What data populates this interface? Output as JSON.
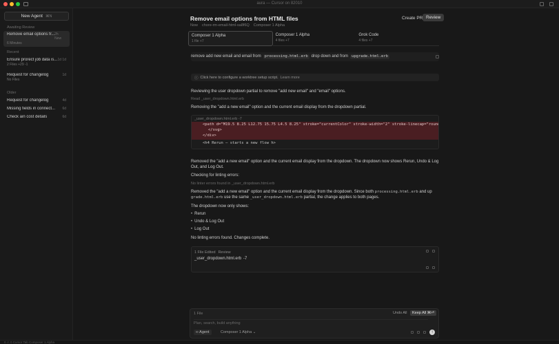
{
  "window": {
    "title": "aura — Cursor on 82010"
  },
  "sidebar": {
    "new_agent_label": "New Agent",
    "new_agent_shortcut": "⌘N",
    "sections": [
      {
        "label": "Awaiting Review"
      },
      {
        "label": "Recent"
      },
      {
        "label": "Older"
      }
    ],
    "items": [
      {
        "title": "Remove email options fr...",
        "time": "2h New",
        "sub": "6 Minutes",
        "section": "Awaiting Review"
      },
      {
        "title": "Ensure prorect job data is...",
        "time": "1d 1d",
        "sub": "2 Files +29 -1",
        "section": "Recent"
      },
      {
        "title": "Request for changelog",
        "time": "1d",
        "sub": "No Files",
        "section": "Recent"
      },
      {
        "title": "Request for changelog",
        "time": "4d",
        "sub": "",
        "section": "Older"
      },
      {
        "title": "Missing fields in connect...",
        "time": "6d",
        "sub": "",
        "section": "Older"
      },
      {
        "title": "Check ain cost details",
        "time": "6d",
        "sub": "",
        "section": "Older"
      }
    ]
  },
  "header": {
    "title": "Remove email options from HTML files",
    "sub_left": "Now",
    "sub_branch": "chore-rm-email-html-sa8f6Q",
    "sub_model": "Composer 1 Alpha",
    "create_pr_label": "Create PR",
    "review_label": "Review"
  },
  "tabs": [
    {
      "name": "Composer 1 Alpha",
      "meta": "1 file  +7"
    },
    {
      "name": "Composer 1 Alpha",
      "meta": "4 files  +7"
    },
    {
      "name": "Grok Code",
      "meta": "4 files  +7"
    }
  ],
  "chat": {
    "prompt_prefix": "remove add new email and email from",
    "prompt_file1": "processing.html.erb",
    "prompt_mid": "drop down and from",
    "prompt_file2": "upgrade.html.erb",
    "info_text": "Click here to configure a worktree setup script.",
    "info_link": "Learn more",
    "msg1": "Reviewing the user dropdown partial to remove \"add new email\" and \"email\" options.",
    "read_label": "Read",
    "read_file": "_user_dropdown.html.erb",
    "msg2": "Removing the \"add a new email\" option and the current email display from the dropdown partial.",
    "diff_file": "_user_dropdown.html.erb",
    "diff_counts": "-7",
    "diff_del1": "<path d=\"M19.5 8.25 L12.75 15.75 L4.5 8.25\" stroke=\"currentColor\" stroke-width=\"2\" stroke-linecap=\"round\" stroke-",
    "diff_del2": "</svg>",
    "diff_del3": "</div>",
    "diff_norm": "<h4 Rerun — starts a new flow h>",
    "msg3": "Removed the \"add a new email\" option and the current email display from the dropdown. The dropdown now shows Rerun, Undo & Log Out, and Log Out.",
    "msg4": "Checking for linting errors:",
    "lint_label": "No linter errors found in",
    "lint_file": "_user_dropdown.html.erb",
    "msg5_a": "Removed the \"add a new email\" option and the current email display from the dropdown. Since both",
    "msg5_file1": "processing.html.erb",
    "msg5_b": "and up",
    "msg5_file2": "grade.html.erb",
    "msg5_c": "use the same",
    "msg5_file3": "_user_dropdown.html.erb",
    "msg5_d": "partial, the change applies to both pages.",
    "msg6": "The dropdown now only shows:",
    "bullets": [
      "Rerun",
      "Undo & Log Out",
      "Log Out"
    ],
    "msg7": "No linting errors found. Changes complete."
  },
  "file_card": {
    "summary": "1 File Edited",
    "review_label": "Review",
    "file_name": "_user_dropdown.html.erb",
    "file_delta": "-7"
  },
  "composer": {
    "files_label": "1 File",
    "undo_label": "Undo All",
    "keep_label": "Keep All",
    "keep_shortcut": "⌘⏎",
    "input_placeholder": "Plan, search, build anything",
    "mode_label": "Agent",
    "model_label": "Composer 1 Alpha"
  },
  "statusbar": {
    "text": "0 ⚠ 0   Cursor Tab   Composer 1 Alpha"
  }
}
